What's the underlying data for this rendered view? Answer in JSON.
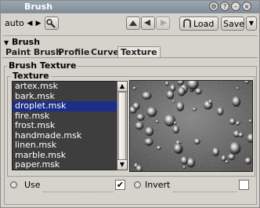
{
  "window": {
    "title": "Brush"
  },
  "titlebar_icons": [
    "gear-icon",
    "help-icon",
    "minimize-icon",
    "close-icon"
  ],
  "toolbar": {
    "preset_value": "auto",
    "load_label": "Load",
    "save_label": "Save"
  },
  "section": {
    "label": "Brush"
  },
  "tabs": [
    {
      "label": "Paint Brush",
      "active": false
    },
    {
      "label": "Profile",
      "active": false
    },
    {
      "label": "Curve",
      "active": false
    },
    {
      "label": "Texture",
      "active": true
    }
  ],
  "group": {
    "outer_label": "Brush Texture",
    "inner_label": "Texture"
  },
  "texture_list": {
    "items": [
      "artex.msk",
      "bark.msk",
      "droplet.msk",
      "fire.msk",
      "frost.msk",
      "handmade.msk",
      "linen.msk",
      "marble.msk",
      "paper.msk"
    ],
    "selected": "droplet.msk"
  },
  "options": {
    "use_label": "Use",
    "use_checked": true,
    "invert_label": "Invert",
    "invert_checked": false
  },
  "colors": {
    "titlebar": "#8a97a2",
    "selection": "#1c2d8a",
    "list_bg": "#3e3e3e"
  }
}
